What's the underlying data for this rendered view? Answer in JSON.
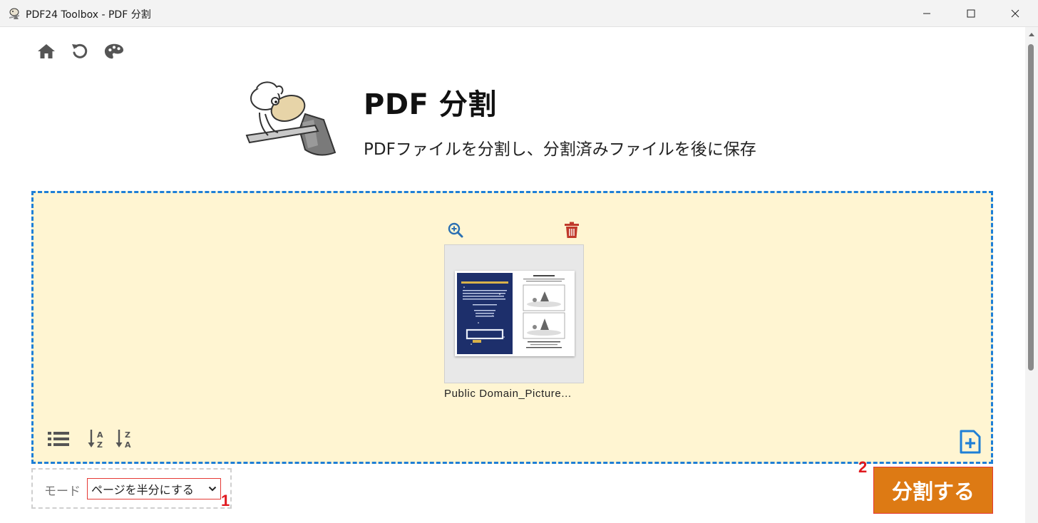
{
  "window": {
    "title": "PDF24 Toolbox - PDF 分割"
  },
  "toolbar": {
    "icons": [
      "home-icon",
      "undo-icon",
      "palette-icon"
    ]
  },
  "header": {
    "title": "PDF 分割",
    "subtitle": "PDFファイルを分割し、分割済みファイルを後に保存"
  },
  "dropzone": {
    "files": [
      {
        "name": "Public Domain_Picture..."
      }
    ],
    "bottom_icons": [
      "list-view-icon",
      "sort-az-icon",
      "sort-za-icon",
      "add-file-icon"
    ]
  },
  "options": {
    "mode_label": "モード",
    "mode_value": "ページを半分にする"
  },
  "actions": {
    "split_label": "分割する"
  },
  "annotations": {
    "callout_1": "1",
    "callout_2": "2"
  },
  "colors": {
    "dropzone_bg": "#fff5d2",
    "dropzone_border": "#1e7fd6",
    "split_button": "#dd7a14",
    "highlight": "#e53935",
    "trash": "#c0392b"
  }
}
